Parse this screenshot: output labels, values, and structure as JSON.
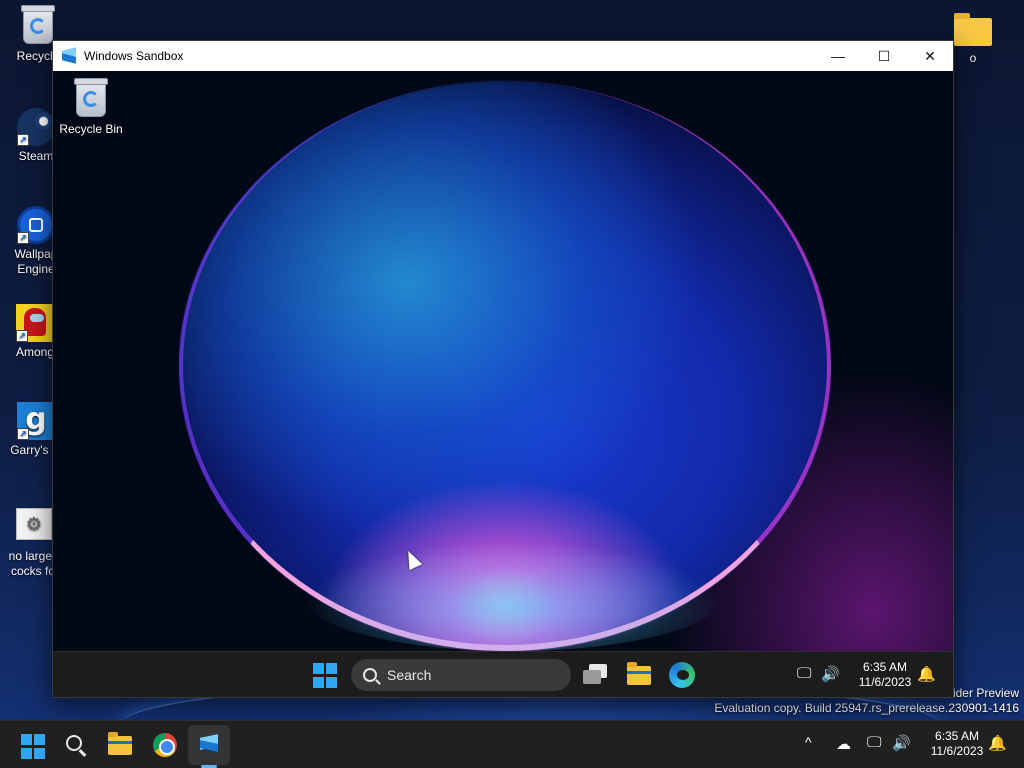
{
  "host": {
    "desktop_icons": [
      {
        "label": "Recycle",
        "icon": "recycle-bin-icon"
      },
      {
        "label": "Steam",
        "icon": "steam-icon"
      },
      {
        "label_line1": "Wallpap",
        "label_line2": "Engine",
        "icon": "wallpaper-engine-icon"
      },
      {
        "label": "Among",
        "icon": "among-us-icon"
      },
      {
        "label": "Garry's M",
        "icon": "garrys-mod-icon"
      },
      {
        "label_line1": "no large s",
        "label_line2": "cocks for",
        "icon": "settings-file-icon"
      },
      {
        "label": "o",
        "icon": "folder-icon"
      }
    ],
    "watermark": {
      "line1": "ider Preview",
      "line2": "Evaluation copy. Build 25947.rs_prerelease.230901-1416"
    },
    "taskbar": {
      "apps": [
        "start-icon",
        "search-icon",
        "file-explorer-icon",
        "chrome-icon",
        "windows-sandbox-icon"
      ],
      "active_app": "windows-sandbox-icon",
      "tray": {
        "chevron": "^",
        "time": "6:35 AM",
        "date": "11/6/2023"
      }
    }
  },
  "sandbox_window": {
    "title": "Windows Sandbox",
    "controls": {
      "minimize": "—",
      "maximize": "☐",
      "close": "✕"
    },
    "desktop_icons": [
      {
        "label": "Recycle Bin",
        "icon": "recycle-bin-icon"
      }
    ],
    "taskbar": {
      "search_placeholder": "Search",
      "apps": [
        "start-icon",
        "task-view-icon",
        "file-explorer-icon",
        "edge-icon"
      ],
      "tray": {
        "time": "6:35 AM",
        "date": "11/6/2023"
      }
    }
  },
  "colors": {
    "accent": "#2fa7f2",
    "taskbar_bg": "#202020",
    "sandbox_taskbar_bg": "#1c1c1c"
  }
}
